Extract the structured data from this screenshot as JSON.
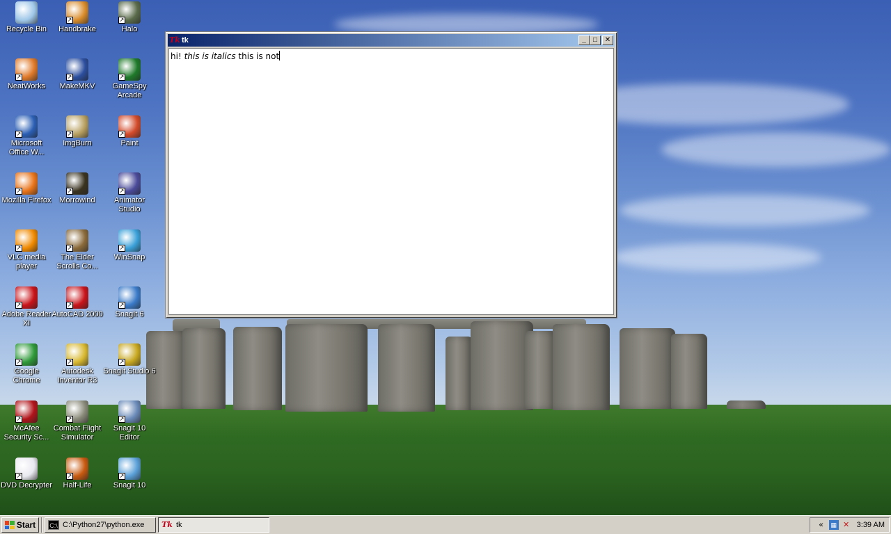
{
  "desktop": {
    "icons": [
      {
        "label": "Recycle Bin",
        "icon": "recycle-bin-icon",
        "color": "#9fc7e8"
      },
      {
        "label": "Handbrake",
        "icon": "handbrake-icon",
        "color": "#d98c2b"
      },
      {
        "label": "Halo",
        "icon": "halo-icon",
        "color": "#5a6b4a"
      },
      {
        "label": "NeatWorks",
        "icon": "neatworks-icon",
        "color": "#e07a2a"
      },
      {
        "label": "MakeMKV",
        "icon": "makemkv-icon",
        "color": "#2b4e9e"
      },
      {
        "label": "GameSpy Arcade",
        "icon": "gamespy-icon",
        "color": "#1f7a2a"
      },
      {
        "label": "Microsoft Office W...",
        "icon": "word-icon",
        "color": "#2b5fb4"
      },
      {
        "label": "ImgBurn",
        "icon": "imgburn-icon",
        "color": "#b8a060"
      },
      {
        "label": "Paint",
        "icon": "paint-icon",
        "color": "#d24a2a"
      },
      {
        "label": "Mozilla Firefox",
        "icon": "firefox-icon",
        "color": "#e8741a"
      },
      {
        "label": "Morrowind",
        "icon": "morrowind-icon",
        "color": "#3a3320"
      },
      {
        "label": "Animator Studio",
        "icon": "animator-studio-icon",
        "color": "#4a4a9a"
      },
      {
        "label": "VLC media player",
        "icon": "vlc-icon",
        "color": "#f08a00"
      },
      {
        "label": "The Elder Scrolls Co...",
        "icon": "elder-scrolls-icon",
        "color": "#8a6a3a"
      },
      {
        "label": "WinSnap",
        "icon": "winsnap-icon",
        "color": "#3aa0d8"
      },
      {
        "label": "Adobe Reader XI",
        "icon": "adobe-reader-icon",
        "color": "#c8141a"
      },
      {
        "label": "AutoCAD 2000",
        "icon": "autocad-icon",
        "color": "#c8141a"
      },
      {
        "label": "SnagIt 6",
        "icon": "snagit6-icon",
        "color": "#3a7ac8"
      },
      {
        "label": "Google Chrome",
        "icon": "chrome-icon",
        "color": "#2f9a3a"
      },
      {
        "label": "Autodesk Inventor R3",
        "icon": "inventor-icon",
        "color": "#d8b830"
      },
      {
        "label": "SnagIt Studio 6",
        "icon": "snagit-studio-icon",
        "color": "#c8a820"
      },
      {
        "label": "McAfee Security Sc...",
        "icon": "mcafee-icon",
        "color": "#b0141a"
      },
      {
        "label": "Combat Flight Simulator",
        "icon": "flight-sim-icon",
        "color": "#8a8a7a"
      },
      {
        "label": "Snagit 10 Editor",
        "icon": "snagit-editor-icon",
        "color": "#6a8ab8"
      },
      {
        "label": "DVD Decrypter",
        "icon": "dvd-decrypter-icon",
        "color": "#e8e8f0"
      },
      {
        "label": "Half-Life",
        "icon": "half-life-icon",
        "color": "#c85a10"
      },
      {
        "label": "Snagit 10",
        "icon": "snagit10-icon",
        "color": "#5aa0d8"
      }
    ]
  },
  "window": {
    "title": "tk",
    "text_plain1": "hi! ",
    "text_italic": "this is italics",
    "text_plain2": " this is not",
    "minimize": "_",
    "maximize": "□",
    "close": "✕"
  },
  "taskbar": {
    "start_label": "Start",
    "tasks": [
      {
        "label": "C:\\Python27\\python.exe",
        "icon": "console-icon",
        "active": false
      },
      {
        "label": "tk",
        "icon": "tk-icon",
        "active": true
      }
    ],
    "tray_expand": "«",
    "clock": "3:39 AM"
  },
  "colors": {
    "titlebar_start": "#0a246a",
    "titlebar_end": "#a6caf0",
    "chrome": "#d4d0c8"
  }
}
